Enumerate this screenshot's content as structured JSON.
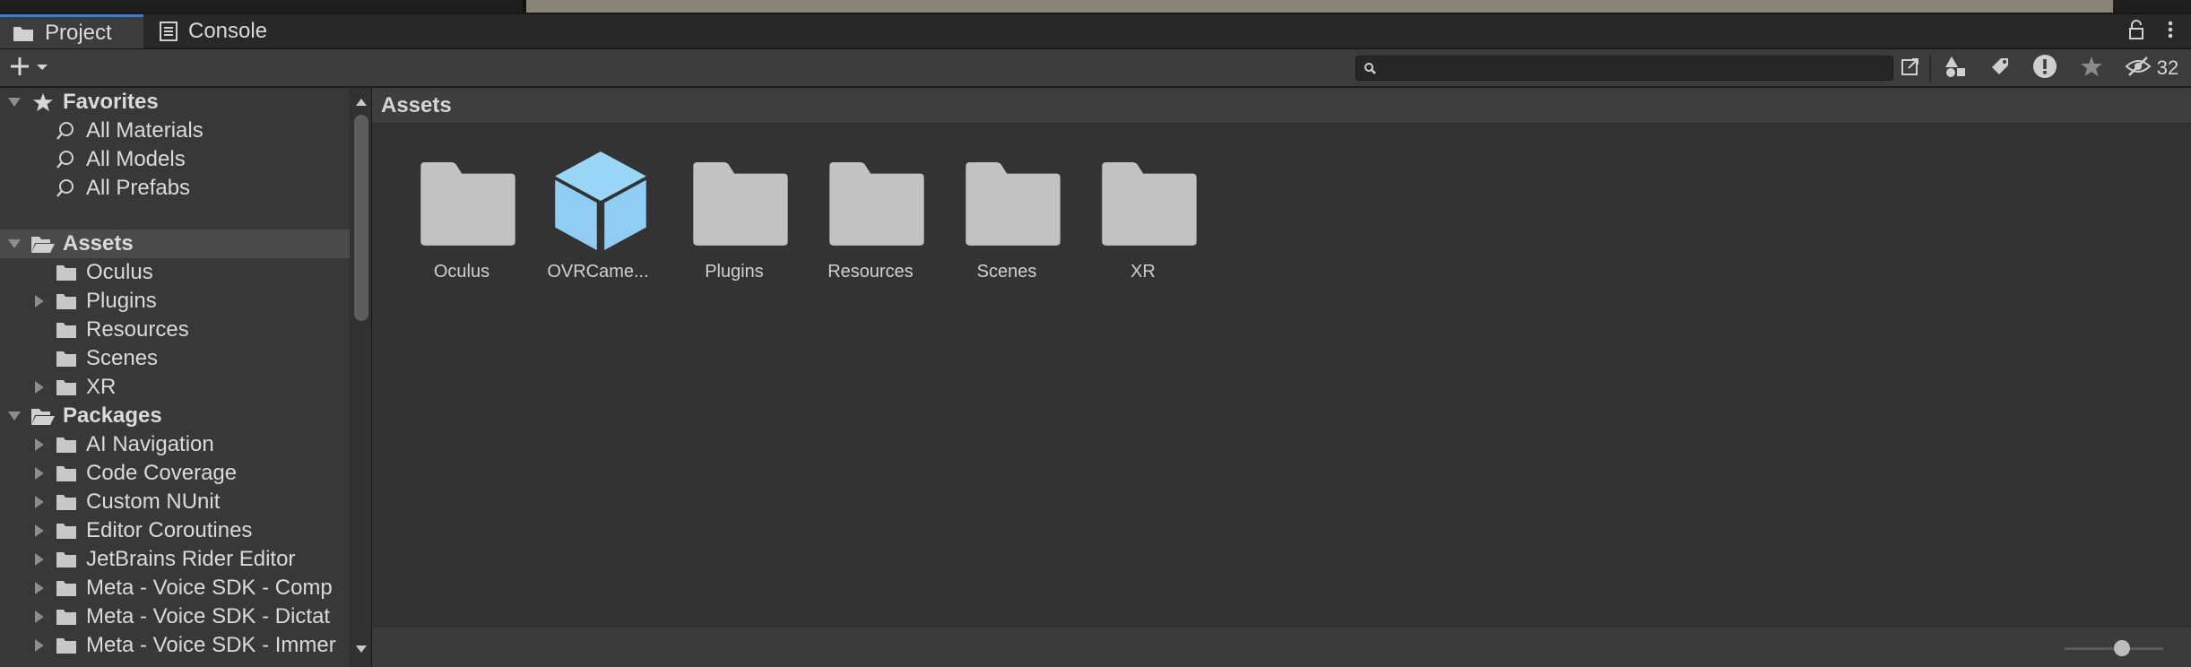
{
  "tabs": [
    {
      "label": "Project",
      "icon": "folder-icon",
      "active": true
    },
    {
      "label": "Console",
      "icon": "console-icon",
      "active": false
    }
  ],
  "toolbar": {
    "search_value": "",
    "hidden_count": "32"
  },
  "tree": {
    "favorites": {
      "label": "Favorites",
      "items": [
        "All Materials",
        "All Models",
        "All Prefabs"
      ]
    },
    "assets": {
      "label": "Assets",
      "items": [
        "Oculus",
        "Plugins",
        "Resources",
        "Scenes",
        "XR"
      ]
    },
    "packages": {
      "label": "Packages",
      "items": [
        "AI Navigation",
        "Code Coverage",
        "Custom NUnit",
        "Editor Coroutines",
        "JetBrains Rider Editor",
        "Meta - Voice SDK - Comp",
        "Meta - Voice SDK - Dictat",
        "Meta - Voice SDK - Immer"
      ]
    }
  },
  "main": {
    "breadcrumb": "Assets",
    "tiles": [
      {
        "name": "Oculus",
        "icon": "folder-icon"
      },
      {
        "name": "OVRCame...",
        "icon": "prefab-cube-icon"
      },
      {
        "name": "Plugins",
        "icon": "folder-icon"
      },
      {
        "name": "Resources",
        "icon": "folder-icon"
      },
      {
        "name": "Scenes",
        "icon": "folder-icon"
      },
      {
        "name": "XR",
        "icon": "folder-icon"
      }
    ],
    "zoom": 0.6
  },
  "colors": {
    "tab_accent": "#3d7fd6",
    "folder": "#c2c2c2",
    "prefab": "#8fcdf5"
  }
}
